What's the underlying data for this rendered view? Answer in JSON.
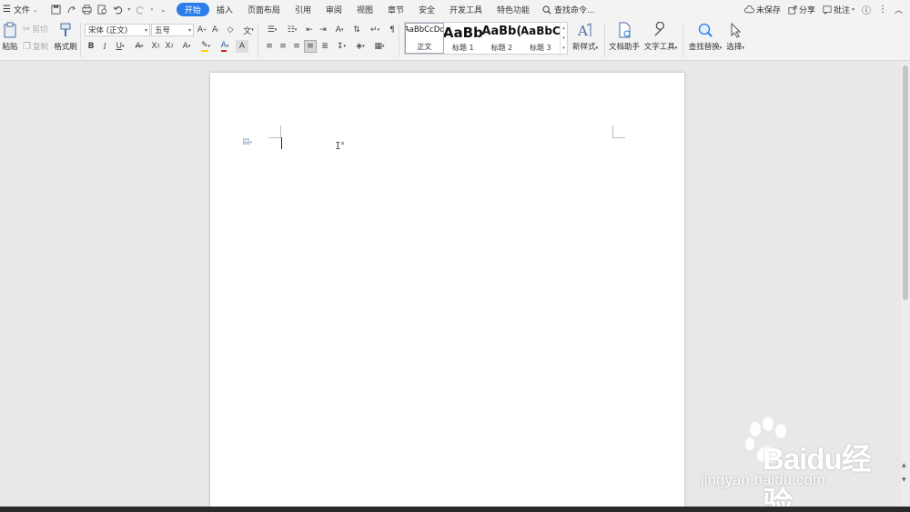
{
  "menubar": {
    "file_label": "文件",
    "tabs": [
      "开始",
      "插入",
      "页面布局",
      "引用",
      "审阅",
      "视图",
      "章节",
      "安全",
      "开发工具",
      "特色功能"
    ],
    "active_tab": "开始",
    "search_label": "查找命令...",
    "right": {
      "unsaved": "未保存",
      "share": "分享",
      "comment": "批注"
    }
  },
  "ribbon": {
    "paste": "粘贴",
    "cut": "剪切",
    "copy": "复制",
    "format_painter": "格式刷",
    "font_name": "宋体 (正文)",
    "font_size": "五号",
    "styles": [
      {
        "preview": "AaBbCcDd",
        "name": "正文"
      },
      {
        "preview": "AaBb",
        "name": "标题 1"
      },
      {
        "preview": "AaBb(",
        "name": "标题 2"
      },
      {
        "preview": "AaBbC",
        "name": "标题 3"
      }
    ],
    "new_style": "新样式",
    "doc_assistant": "文档助手",
    "text_tools": "文字工具",
    "find_replace": "查找替换",
    "select": "选择"
  },
  "watermark": {
    "brand": "Baidu经验",
    "url": "jingyan.baidu.com"
  },
  "colors": {
    "accent": "#2b7de9",
    "font_color": "#e02020",
    "highlight": "#ffd800"
  }
}
